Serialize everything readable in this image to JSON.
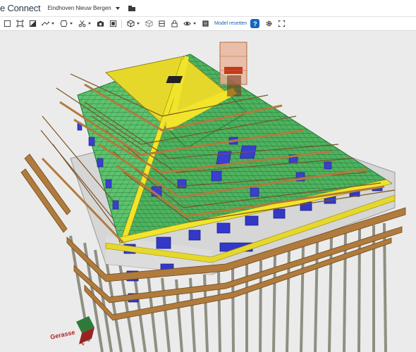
{
  "header": {
    "app_title": "e Connect",
    "project_name": "Eindhoven Nieuw Bergen",
    "folder_icon": "folder-icon"
  },
  "toolbar": {
    "reset_label": "Model resetten",
    "help_label": "?",
    "tools": [
      "select-box-icon",
      "fit-view-icon",
      "section-box-icon",
      "measure-icon",
      "shape-icon",
      "cut-icon",
      "camera-icon",
      "color-icon",
      "cube-icon",
      "isolate-icon",
      "lock-icon",
      "visibility-icon",
      "settings-panel-icon",
      "gear-icon",
      "fullscreen-icon"
    ]
  },
  "viewport": {
    "nav_cube_label": "Gerasse",
    "colors": {
      "scaffold": "#b07b3c",
      "roof": "#e6d82a",
      "roof_grid": "#3fae5a",
      "window": "#3338c8",
      "wall": "#d8d8d8",
      "piles": "#9a9a8c",
      "chimney": "#e6a98a"
    }
  }
}
